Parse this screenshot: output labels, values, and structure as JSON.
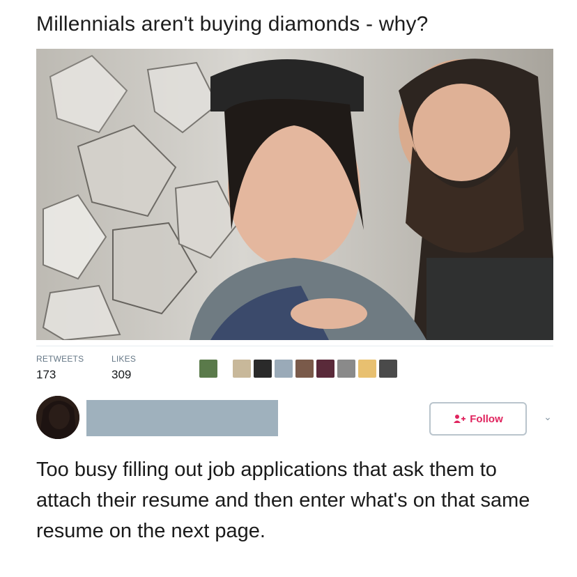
{
  "headline": "Millennials aren't buying diamonds - why?",
  "stats": {
    "retweets_label": "RETWEETS",
    "retweets_value": "173",
    "likes_label": "LIKES",
    "likes_value": "309"
  },
  "likers": [
    {
      "color": "#5a7a4a"
    },
    {
      "color": "#c8b89a"
    },
    {
      "color": "#2a2a2a"
    },
    {
      "color": "#9aaab8"
    },
    {
      "color": "#7a5a4a"
    },
    {
      "color": "#5a2a3a"
    },
    {
      "color": "#8a8a8a"
    },
    {
      "color": "#e8c070"
    },
    {
      "color": "#4a4a4a"
    }
  ],
  "author": {
    "avatar_icon": "user-avatar"
  },
  "follow": {
    "label": "Follow",
    "icon": "add-user-icon",
    "color": "#e0245e"
  },
  "menu": {
    "icon": "chevron-down-icon",
    "glyph": "⌄"
  },
  "tweet": {
    "text": "Too busy filling out job applications that ask them to attach their resume and then enter what's on that same resume on the next page."
  }
}
